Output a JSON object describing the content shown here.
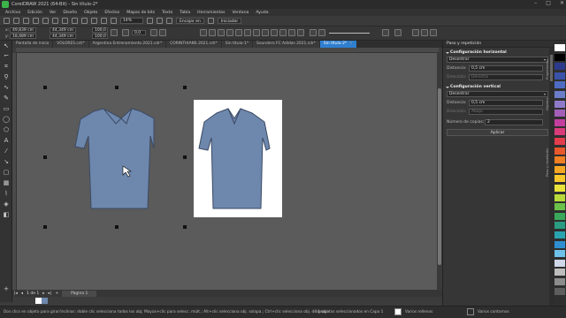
{
  "window": {
    "title": "CorelDRAW 2021 (64-Bit) - Sin título-2*",
    "controls": [
      "–",
      "□",
      "✕"
    ]
  },
  "menu": [
    "Archivo",
    "Edición",
    "Ver",
    "Diseño",
    "Objeto",
    "Efectos",
    "Mapas de bits",
    "Texto",
    "Tabla",
    "Herramientas",
    "Ventana",
    "Ayuda"
  ],
  "toolbar": {
    "zoom": "14%",
    "snap": "Encajar en",
    "settings": "Iniciador"
  },
  "propbar": {
    "x": "49,839 cm",
    "y": "18,489 cm",
    "w": "44,349 cm",
    "h": "44,349 cm",
    "sx": "100,0",
    "sy": "100,0",
    "angle": "0,0"
  },
  "tabs": [
    {
      "label": "Pantalla de inicio",
      "active": false
    },
    {
      "label": "VOLORES.cdr*",
      "active": false
    },
    {
      "label": "Argentina Entrenamiento 2021.cdr*",
      "active": false
    },
    {
      "label": "CORINTHIANS 2021.cdr*",
      "active": false
    },
    {
      "label": "Sin título-1*",
      "active": false
    },
    {
      "label": "Sounders FC Adidas 2021.cdr*",
      "active": false
    },
    {
      "label": "Sin título-2*",
      "active": true
    }
  ],
  "pagebar": {
    "counter": "1 de 1",
    "page_tab": "Página 1"
  },
  "docker": {
    "title": "Paso y repetición",
    "horizontal": {
      "title": "Configuración horizontal",
      "mode": "Desentrar",
      "distance_label": "Distancia:",
      "distance": "0,5 cm",
      "direction_label": "Dirección:",
      "direction": "Derecha"
    },
    "vertical": {
      "title": "Configuración vertical",
      "mode": "Desentrar",
      "distance_label": "Distancia:",
      "distance": "0,5 cm",
      "direction_label": "Dirección:",
      "direction": "Abajo"
    },
    "copies_label": "Número de copias:",
    "copies": "2",
    "apply": "Aplicar"
  },
  "status": {
    "hint": "Dos clics en objeto para girar/inclinar; doble clic selecciona todos los obj; Mayús+clic para selecc. múlt.; Alt+clic selecciona obj. solapa.; Ctrl+clic selecciona obj. de grupo",
    "selection": "14 objetos seleccionados en Capa 1",
    "fill": "Varios rellenos",
    "outline": "Varios contornos"
  },
  "colors": {
    "shirt": "#6e87ad",
    "shirt_dark": "#3b4a63",
    "accent": "#2f7fcf"
  },
  "palette": [
    "#ffffff",
    "#000000",
    "#2d3a8c",
    "#3a52a8",
    "#4d6bc2",
    "#6b7dc9",
    "#8f7ac9",
    "#a35fb8",
    "#c23fa0",
    "#d83c7a",
    "#e23d4d",
    "#e8582b",
    "#ef7f23",
    "#f5a623",
    "#f7c72b",
    "#e9e23a",
    "#b8d93a",
    "#6bc24a",
    "#39a85a",
    "#2a9c82",
    "#2aa3b0",
    "#2f8ecf",
    "#6ec1e8",
    "#cfd8e8",
    "#bdbdbd",
    "#8c8c8c",
    "#5e5e5e"
  ],
  "icons": {
    "select": "pointer-icon",
    "shape": "shape-icon",
    "crop": "crop-icon",
    "zoom": "zoom-icon",
    "freehand": "freehand-icon",
    "rect": "rectangle-icon",
    "ellipse": "ellipse-icon",
    "polygon": "polygon-icon",
    "text": "text-icon",
    "line": "parallel-line-icon",
    "connector": "connector-icon",
    "shadow": "shadow-icon",
    "transparency": "transparency-icon",
    "eyedropper": "eyedropper-icon",
    "fill": "fill-icon",
    "interactive": "interactive-fill-icon"
  }
}
